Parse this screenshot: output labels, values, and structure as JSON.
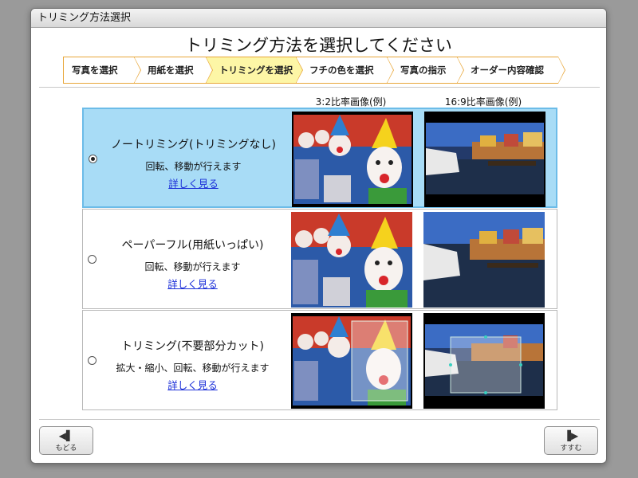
{
  "window": {
    "title": "トリミング方法選択"
  },
  "heading": "トリミング方法を選択してください",
  "steps": [
    {
      "label": "写真を選択"
    },
    {
      "label": "用紙を選択"
    },
    {
      "label": "トリミングを選択",
      "active": true
    },
    {
      "label": "フチの色を選択"
    },
    {
      "label": "写真の指示"
    },
    {
      "label": "オーダー内容確認"
    }
  ],
  "columns": {
    "ratio_32": "3:2比率画像(例)",
    "ratio_169": "16:9比率画像(例)"
  },
  "options": [
    {
      "title": "ノートリミング(トリミングなし)",
      "desc": "回転、移動が行えます",
      "link": "詳しく見る",
      "selected": true
    },
    {
      "title": "ペーパーフル(用紙いっぱい)",
      "desc": "回転、移動が行えます",
      "link": "詳しく見る",
      "selected": false
    },
    {
      "title": "トリミング(不要部分カット)",
      "desc": "拡大・縮小、回転、移動が行えます",
      "link": "詳しく見る",
      "selected": false
    }
  ],
  "nav": {
    "back": {
      "icon": "back-icon",
      "label": "もどる"
    },
    "next": {
      "icon": "next-icon",
      "label": "すすむ"
    }
  },
  "colors": {
    "accent": "#e8a73a",
    "active_step": "#fdf6a6",
    "selected_row": "#a8dcf6",
    "link": "#1a2ed8"
  }
}
